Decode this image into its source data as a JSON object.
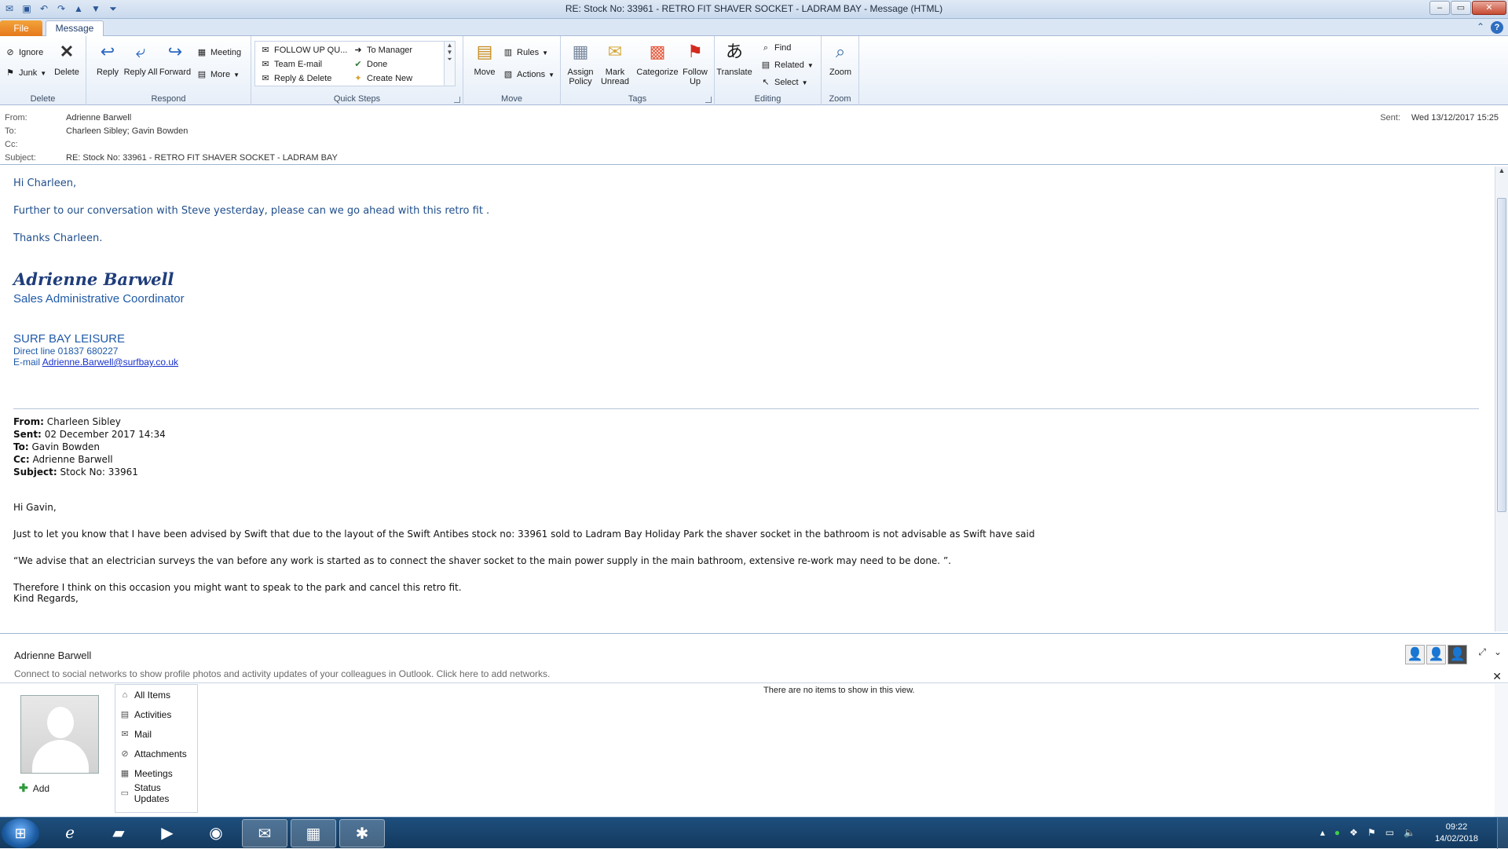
{
  "window": {
    "title": "RE: Stock No: 33961 - RETRO FIT SHAVER SOCKET - LADRAM BAY  - Message (HTML)"
  },
  "tabs": {
    "file": "File",
    "message": "Message"
  },
  "ribbon": {
    "delete_group": {
      "label": "Delete",
      "ignore": "Ignore",
      "junk": "Junk",
      "delete": "Delete"
    },
    "respond_group": {
      "label": "Respond",
      "reply": "Reply",
      "reply_all": "Reply All",
      "forward": "Forward",
      "meeting": "Meeting",
      "more": "More"
    },
    "quick_steps": {
      "label": "Quick Steps",
      "items": [
        "FOLLOW UP QU...",
        "Team E-mail",
        "Reply & Delete",
        "To Manager",
        "Done",
        "Create New"
      ]
    },
    "move_group": {
      "label": "Move",
      "move": "Move",
      "rules": "Rules",
      "actions": "Actions"
    },
    "tags_group": {
      "label": "Tags",
      "assign_policy": "Assign Policy",
      "mark_unread": "Mark Unread",
      "categorize": "Categorize",
      "follow_up": "Follow Up"
    },
    "editing_group": {
      "label": "Editing",
      "translate": "Translate",
      "find": "Find",
      "related": "Related",
      "select": "Select"
    },
    "zoom_group": {
      "label": "Zoom",
      "zoom": "Zoom"
    }
  },
  "header": {
    "from_label": "From:",
    "from": "Adrienne Barwell",
    "to_label": "To:",
    "to": "Charleen Sibley; Gavin Bowden",
    "cc_label": "Cc:",
    "cc": "",
    "subject_label": "Subject:",
    "subject": "RE: Stock No: 33961 - RETRO FIT SHAVER SOCKET - LADRAM BAY",
    "sent_label": "Sent:",
    "sent": "Wed 13/12/2017 15:25"
  },
  "body": {
    "greeting": "Hi Charleen,",
    "para1": "Further to our conversation with Steve yesterday, please can we go ahead with this retro fit .",
    "thanks": "Thanks Charleen.",
    "signature": {
      "name": "Adrienne Barwell",
      "role": "Sales Administrative Coordinator",
      "company": "SURF BAY LEISURE",
      "direct_line": "Direct line 01837 680227",
      "email_label": "E-mail",
      "email": "Adrienne.Barwell@surfbay.co.uk"
    },
    "quoted": {
      "from_label": "From:",
      "from": "Charleen Sibley",
      "sent_label": "Sent:",
      "sent": "02 December 2017 14:34",
      "to_label": "To:",
      "to": "Gavin Bowden",
      "cc_label": "Cc:",
      "cc": "Adrienne Barwell",
      "subject_label": "Subject:",
      "subject": "Stock No: 33961",
      "greeting": "Hi Gavin,",
      "para1": "Just to let you know that I have been advised by Swift that due to the layout of the Swift Antibes stock no: 33961 sold to Ladram Bay Holiday Park the shaver socket in the bathroom is not advisable as Swift have said",
      "para2": "“We advise that an electrician surveys the van before any work is started as to connect the shaver socket to the main power supply in the main bathroom, extensive re-work may need to be done. ”.",
      "para3": "Therefore I think on this occasion you might want to speak to the park and cancel this retro fit.",
      "closing": "Kind Regards,"
    }
  },
  "people_pane": {
    "name": "Adrienne Barwell",
    "note": "Connect to social networks to show profile photos and activity updates of your colleagues in Outlook. Click here to add networks.",
    "add": "Add",
    "items": [
      "All Items",
      "Activities",
      "Mail",
      "Attachments",
      "Meetings",
      "Status Updates"
    ],
    "empty": "There are no items to show in this view."
  },
  "taskbar": {
    "time": "09:22",
    "date": "14/02/2018"
  }
}
